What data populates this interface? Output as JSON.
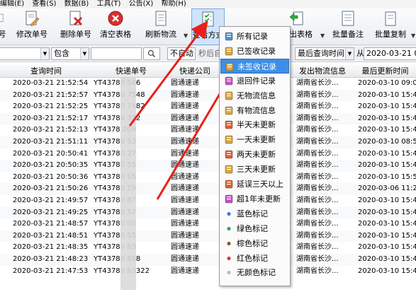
{
  "menubar": {
    "items": [
      "编辑(E)",
      "查看(S)",
      "数据(B)",
      "工具(T)",
      "公告(X)",
      "帮助(H)"
    ]
  },
  "toolbar": {
    "buttons": [
      {
        "label": "号",
        "icon": "doc-icon"
      },
      {
        "label": "修改单号",
        "icon": "edit-doc-icon"
      },
      {
        "label": "删除单号",
        "icon": "delete-doc-icon"
      },
      {
        "label": "清空表格",
        "icon": "clear-table-icon"
      },
      {
        "label": "刷新物流",
        "icon": "refresh-doc-icon"
      },
      {
        "label": "查看方式",
        "icon": "view-mode-icon"
      },
      {
        "label": "导出表格",
        "icon": "export-icon"
      },
      {
        "label": "批量备注",
        "icon": "batch-note-icon"
      },
      {
        "label": "批量复制",
        "icon": "batch-copy-icon"
      }
    ]
  },
  "filterbar": {
    "contains": "包含",
    "auto_label": "不自动",
    "refresh_after": "秒后自",
    "sort_field": "最后查询时间",
    "from_label": "从",
    "from_date": "2020-03-21 00"
  },
  "table": {
    "columns": [
      "查询时间",
      "快递单号",
      "快递公司",
      "发出物流信息",
      "最后更新时间"
    ],
    "rows": [
      {
        "date": "2020-03-21 21:52:54",
        "track": "YT43780  586",
        "comp": "圆通速递",
        "from": "湖南省长沙...",
        "upd": "2020-03-10 09:08"
      },
      {
        "date": "2020-03-21 21:52:57",
        "track": "YT43780  7548",
        "comp": "圆通速递",
        "from": "湖南省长沙...",
        "upd": "2020-03-10 15:42"
      },
      {
        "date": "2020-03-21 21:52:25",
        "track": "YT43780  7482",
        "comp": "圆通速递",
        "from": "湖南省长沙...",
        "upd": "2020-03-10 15:42"
      },
      {
        "date": "2020-03-21 21:52:17",
        "track": "YT43780  332",
        "comp": "圆通速递",
        "from": "湖南省长沙...",
        "upd": "2020-03-10 15:41"
      },
      {
        "date": "2020-03-21 21:52:13",
        "track": "YT4378  009",
        "comp": "圆通速递",
        "from": "湖南省长沙...",
        "upd": "2020-03-10 15:41"
      },
      {
        "date": "2020-03-21 21:51:11",
        "track": "YT43780  53",
        "comp": "圆通速递",
        "from": "湖南省长沙...",
        "upd": "2020-03-10 08:57"
      },
      {
        "date": "2020-03-21 20:50:41",
        "track": "YT43780  27",
        "comp": "圆通速递",
        "from": "湖南省长沙...",
        "upd": "2020-03-10 15:41"
      },
      {
        "date": "2020-03-21 20:50:35",
        "track": "YT43780  55",
        "comp": "圆通速递",
        "from": "湖南省长沙...",
        "upd": "2020-03-10 15:41"
      },
      {
        "date": "2020-03-21 20:50:36",
        "track": "YT43780  55",
        "comp": "圆通速递",
        "from": "湖南省长沙...",
        "upd": "2020-03-10 15:58"
      },
      {
        "date": "2020-03-21 21:50:26",
        "track": "YT43780  19",
        "comp": "圆通速递",
        "from": "湖南省长沙...",
        "upd": "2020-03-06 11:28"
      },
      {
        "date": "2020-03-21 21:49:57",
        "track": "YT43780  87",
        "comp": "圆通速递",
        "from": "湖南省长沙...",
        "upd": "2020-03-10 15:41"
      },
      {
        "date": "2020-03-21 21:49:25",
        "track": "YT43780  57",
        "comp": "圆通速递",
        "from": "湖南省长沙...",
        "upd": "2020-03-10 15:41"
      },
      {
        "date": "2020-03-21 21:48:57",
        "track": "YT43780  00",
        "comp": "圆通速递",
        "from": "湖南省长沙...",
        "upd": "2020-03-10 15:41"
      },
      {
        "date": "2020-03-21 21:48:51",
        "track": "YT43780  55",
        "comp": "圆通速递",
        "from": "湖南省长沙...",
        "upd": "2020-03-10 15:41"
      },
      {
        "date": "2020-03-21 21:48:35",
        "track": "YT43780  83",
        "comp": "圆通速递",
        "from": "湖南省长沙...",
        "upd": "2020-03-10 15:41"
      },
      {
        "date": "2020-03-21 21:48:23",
        "track": "YT43780  688",
        "comp": "圆通速递",
        "from": "湖南省长沙...",
        "upd": "2020-03-10 15:41"
      },
      {
        "date": "2020-03-21 21:47:53",
        "track": "YT43780  63322",
        "comp": "圆通速递",
        "from": "湖南省长沙...",
        "upd": "2020-03-10 15:41"
      }
    ]
  },
  "context_menu": {
    "items": [
      {
        "label": "所有记录",
        "icon": "all-records-icon",
        "color": "#4a90d9"
      },
      {
        "label": "已签收记录",
        "icon": "signed-icon",
        "color": "#d9a43a"
      },
      {
        "label": "未签收记录",
        "icon": "unsigned-icon",
        "color": "#d9a43a",
        "selected": true
      },
      {
        "label": "退回件记录",
        "icon": "returned-icon",
        "color": "#c64fc6"
      },
      {
        "label": "无物流信息",
        "icon": "no-logistics-icon",
        "color": "#d9a43a"
      },
      {
        "label": "有物流信息",
        "icon": "has-logistics-icon",
        "color": "#d9a43a"
      },
      {
        "label": "半天未更新",
        "icon": "half-day-icon",
        "color": "#e35b2a"
      },
      {
        "label": "一天未更新",
        "icon": "one-day-icon",
        "color": "#d9a43a"
      },
      {
        "label": "两天未更新",
        "icon": "two-day-icon",
        "color": "#e35b2a"
      },
      {
        "label": "三天未更新",
        "icon": "three-day-icon",
        "color": "#d9a43a"
      },
      {
        "label": "延误三天以上",
        "icon": "delay-icon",
        "color": "#e35b2a"
      },
      {
        "label": "超1年未更新",
        "icon": "over-year-icon",
        "color": "#c64fc6"
      },
      {
        "label": "蓝色标记",
        "icon": "blue-dot-icon",
        "color": "#3a7bd5"
      },
      {
        "label": "绿色标记",
        "icon": "green-dot-icon",
        "color": "#39a845"
      },
      {
        "label": "棕色标记",
        "icon": "brown-dot-icon",
        "color": "#8b5a2b"
      },
      {
        "label": "红色标记",
        "icon": "red-dot-icon",
        "color": "#d93a3a"
      },
      {
        "label": "无颜色标记",
        "icon": "no-color-dot-icon",
        "color": "#bdbdbd"
      }
    ]
  },
  "annotation": {
    "arrow_color": "#e8201a"
  }
}
